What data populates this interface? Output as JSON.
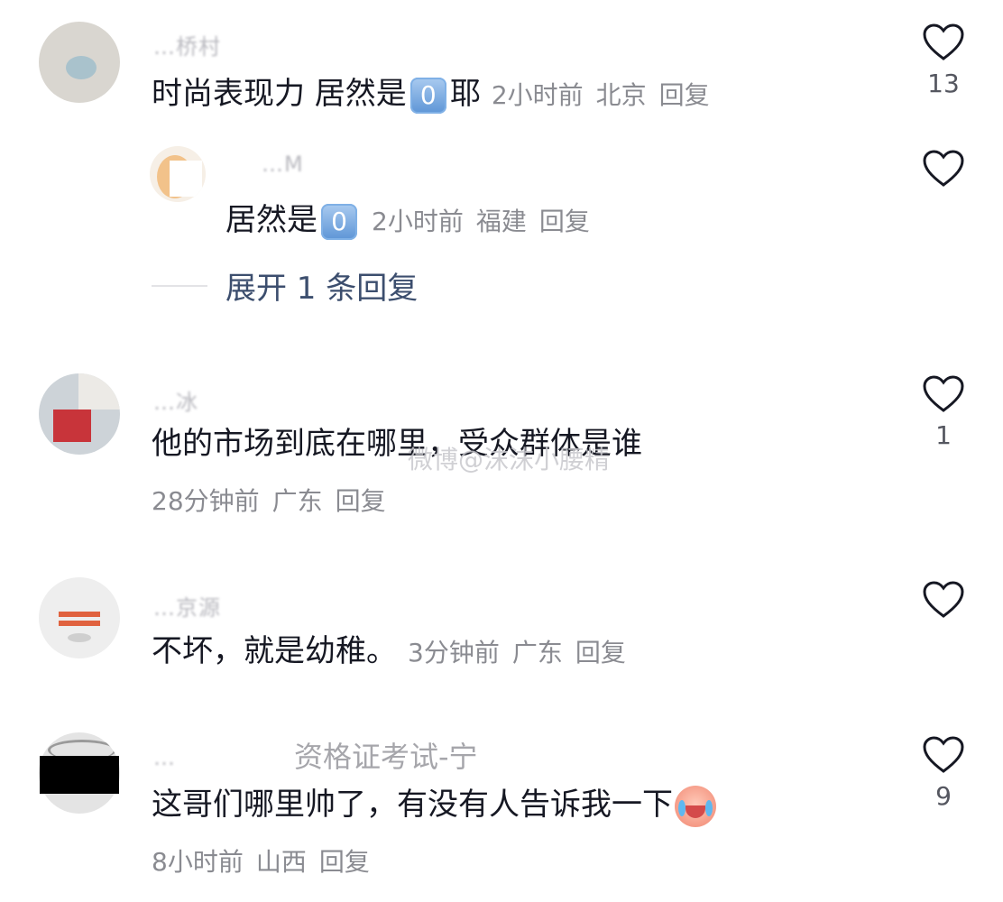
{
  "comments": [
    {
      "username": "…桥村",
      "text_a": "时尚表现力 居然是",
      "badge": "0",
      "text_b": "耶",
      "time": "2小时前",
      "location": "北京",
      "reply": "回复",
      "likes": "13"
    },
    {
      "username": "…M",
      "text_a": "居然是",
      "badge": "0",
      "time": "2小时前",
      "location": "福建",
      "reply": "回复",
      "likes": ""
    },
    {
      "username": "…冰",
      "text": "他的市场到底在哪里，受众群体是谁",
      "time": "28分钟前",
      "location": "广东",
      "reply": "回复",
      "likes": "1"
    },
    {
      "username": "…京源",
      "text": "不坏，就是幼稚。",
      "time": "3分钟前",
      "location": "广东",
      "reply": "回复",
      "likes": ""
    },
    {
      "username": "…",
      "username_suffix": "资格证考试-宁",
      "text": "这哥们哪里帅了，有没有人告诉我一下",
      "time": "8小时前",
      "location": "山西",
      "reply": "回复",
      "likes": "9"
    }
  ],
  "expand_replies": "展开 1 条回复",
  "watermark": "微博@沫沫小腰精",
  "colors": {
    "like_stroke": "#161823",
    "meta": "#8a8b91",
    "expand": "#3c4e6e"
  }
}
